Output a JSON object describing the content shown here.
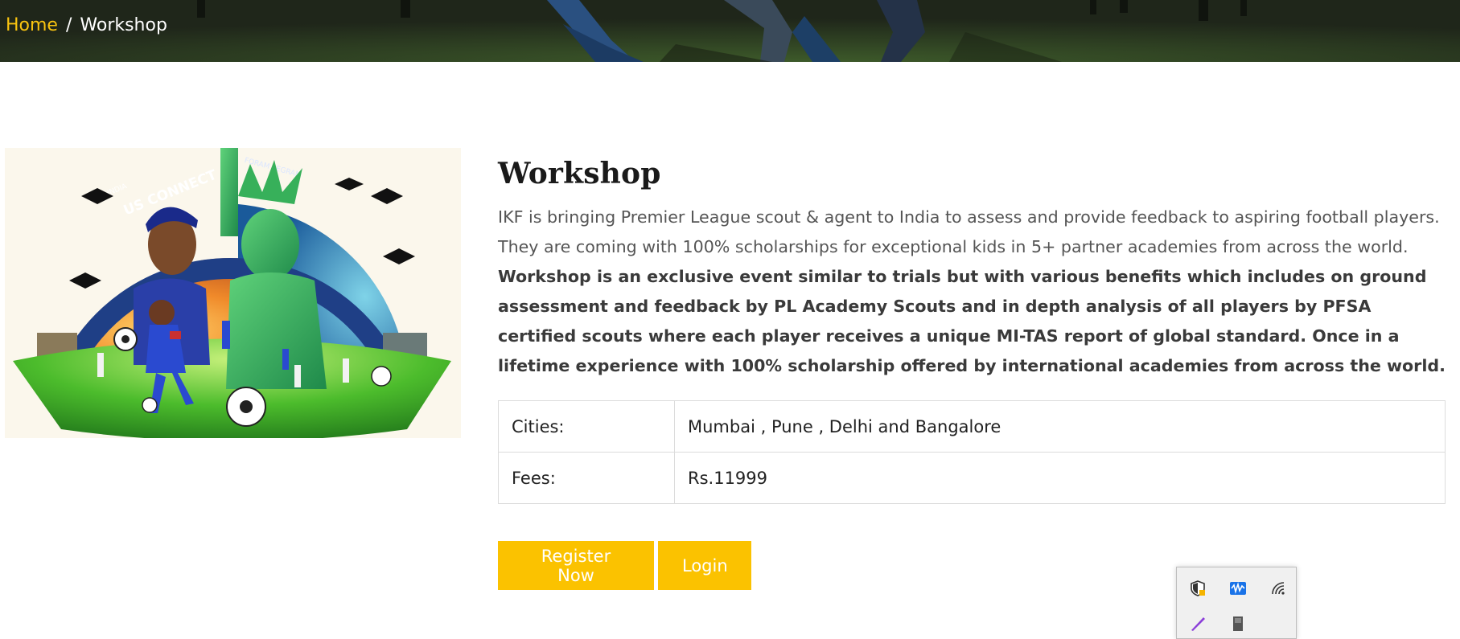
{
  "breadcrumb": {
    "home": "Home",
    "separator": "/",
    "current": "Workshop"
  },
  "image": {
    "text_top": "INDIA",
    "text_main": "US CONNECT",
    "text_ring_right": "FORAM PEGRAM"
  },
  "workshop": {
    "title": "Workshop",
    "description": "IKF is bringing Premier League scout & agent to India to assess and provide feedback to aspiring football players. They are coming with 100% scholarships for exceptional kids in 5+ partner academies from across the world.",
    "highlight": "Workshop is an exclusive event similar to trials but with various benefits which includes on ground assessment and feedback by PL Academy Scouts and in depth analysis of all players by PFSA certified scouts where each player receives a unique MI-TAS report of global standard. Once in a lifetime experience with 100% scholarship offered by international academies from across the world.",
    "details": [
      {
        "label": "Cities:",
        "value": "Mumbai , Pune , Delhi and Bangalore"
      },
      {
        "label": "Fees:",
        "value": "Rs.11999"
      }
    ]
  },
  "actions": {
    "register_label": "Register Now",
    "login_label": "Login"
  },
  "tray": {
    "icons": [
      "security-shield-icon",
      "waveform-app-icon",
      "wifi-icon",
      "pen-app-icon",
      "device-icon"
    ]
  },
  "colors": {
    "accent": "#fbc200",
    "breadcrumb_link": "#f9c410",
    "hero_bg": "#2a3320"
  }
}
